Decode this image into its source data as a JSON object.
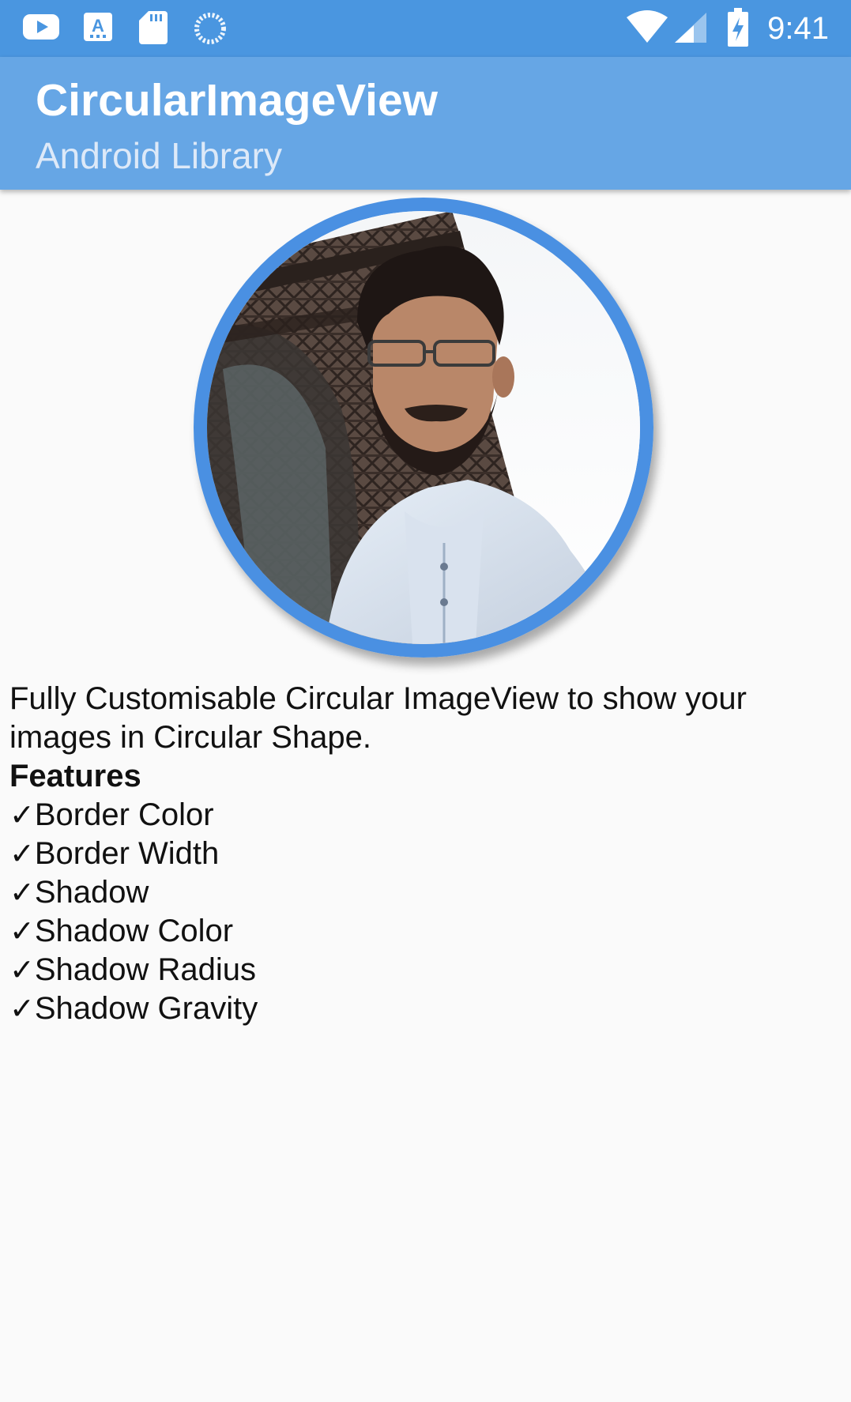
{
  "status_bar": {
    "time": "9:41",
    "left_icons": [
      "youtube-icon",
      "font-download-icon",
      "sd-card-icon",
      "sync-loading-icon"
    ],
    "right_icons": [
      "wifi-icon",
      "signal-icon",
      "battery-charging-icon"
    ]
  },
  "app_bar": {
    "title": "CircularImageView",
    "subtitle": "Android Library",
    "color": "#66a6e5"
  },
  "avatar": {
    "border_color": "#4a90e2",
    "icon": "profile-photo"
  },
  "description": {
    "intro": "Fully Customisable Circular ImageView to show your images in Circular Shape.",
    "features_heading": "Features",
    "check_mark": "✓",
    "features": [
      "Border Color",
      "Border Width",
      "Shadow",
      "Shadow Color",
      "Shadow Radius",
      "Shadow Gravity"
    ]
  }
}
